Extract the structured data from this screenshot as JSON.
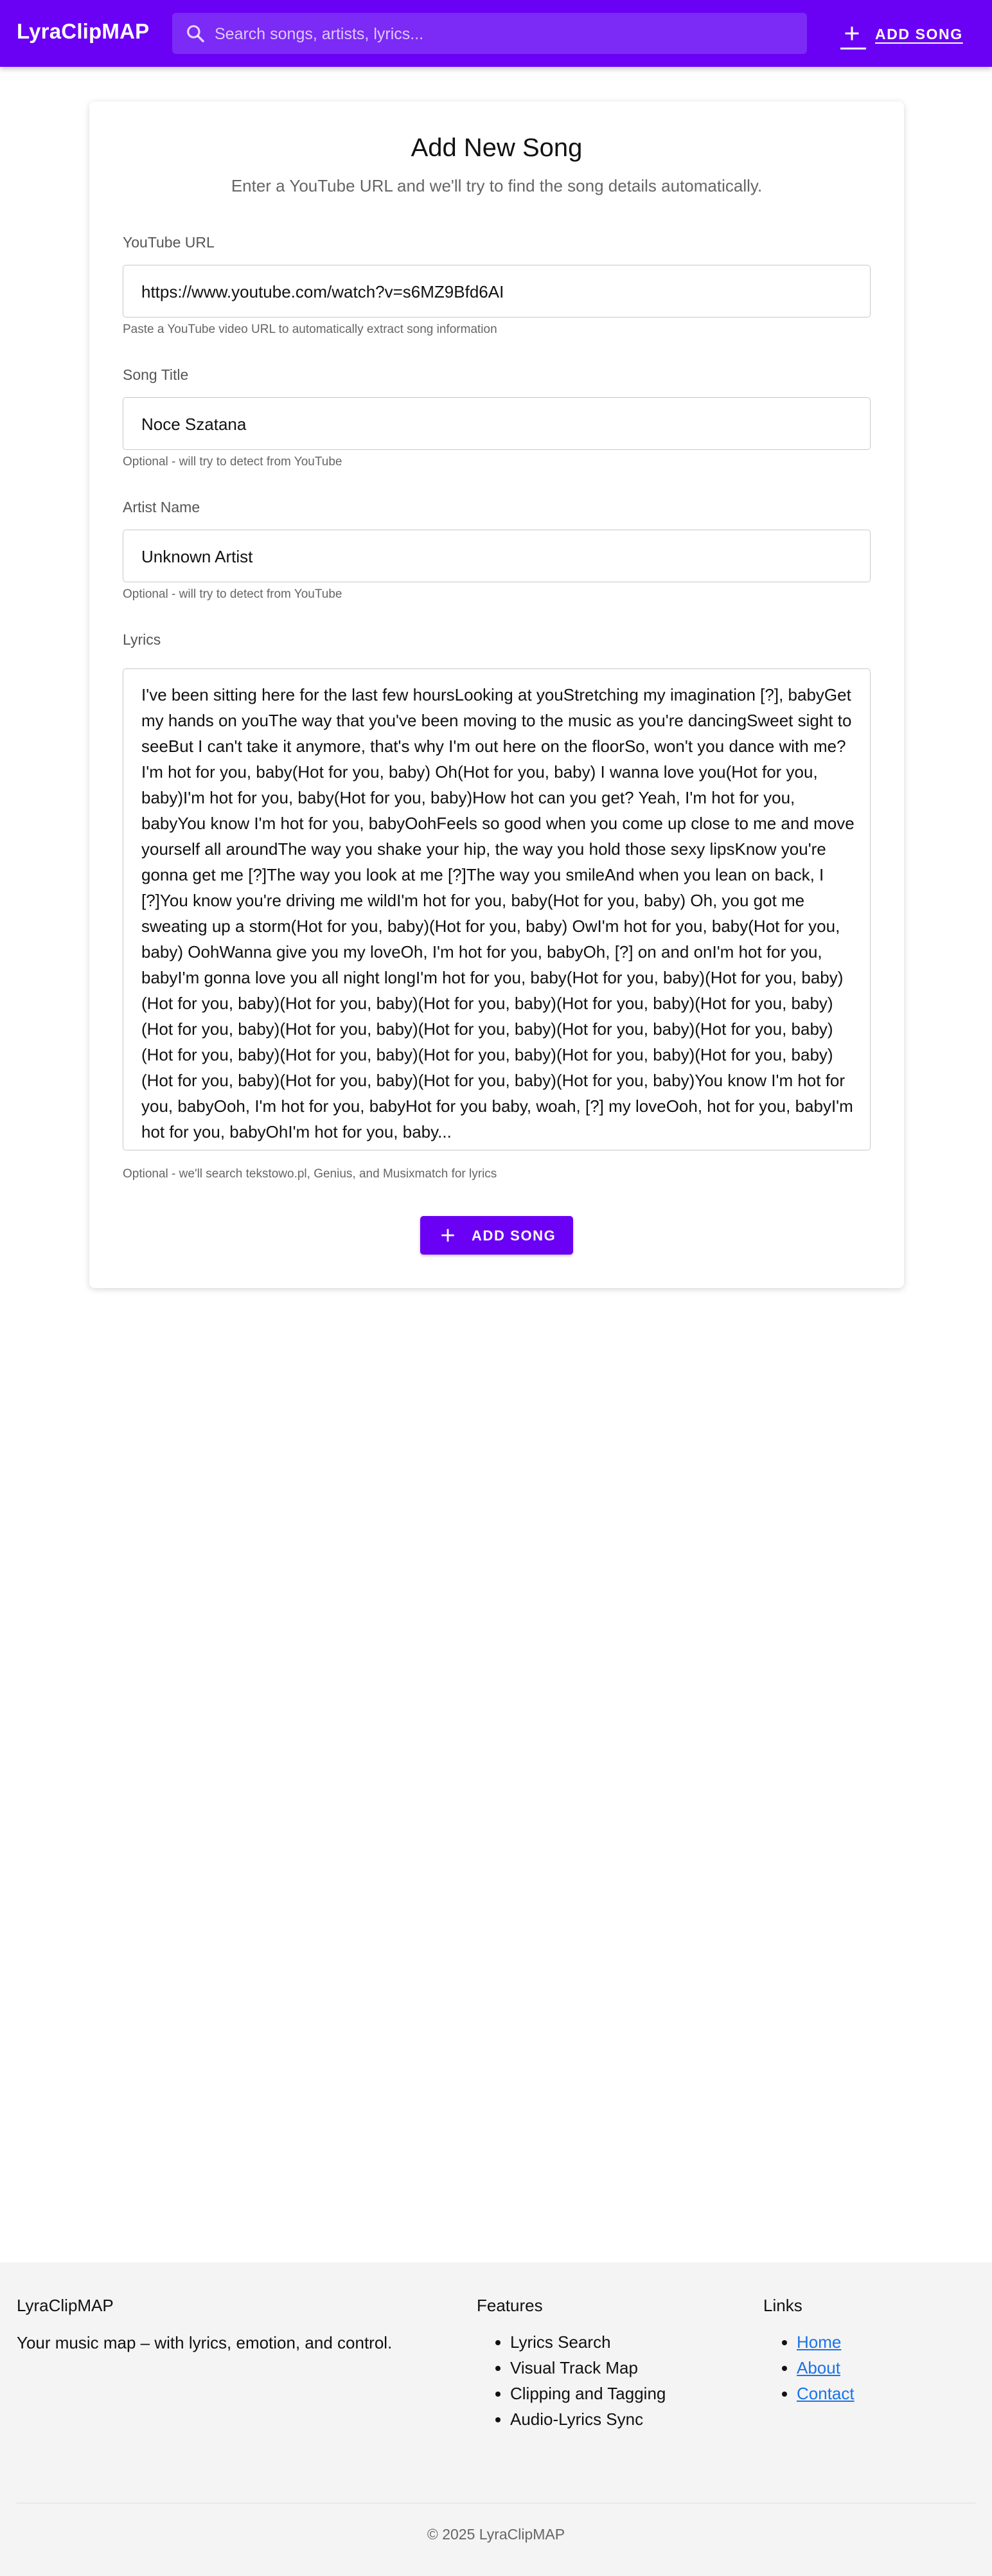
{
  "header": {
    "brand": "LyraClipMAP",
    "search_placeholder": "Search songs, artists, lyrics...",
    "add_song_label": "ADD SONG",
    "search_icon": "search-icon",
    "add_icon": "plus-icon"
  },
  "form": {
    "title": "Add New Song",
    "subtitle": "Enter a YouTube URL and we'll try to find the song details automatically.",
    "youtube": {
      "label": "YouTube URL",
      "value": "https://www.youtube.com/watch?v=s6MZ9Bfd6AI",
      "hint": "Paste a YouTube video URL to automatically extract song information"
    },
    "song_title": {
      "label": "Song Title",
      "value": "Noce Szatana",
      "hint": "Optional - will try to detect from YouTube"
    },
    "artist": {
      "label": "Artist Name",
      "value": "Unknown Artist",
      "hint": "Optional - will try to detect from YouTube"
    },
    "lyrics": {
      "label": "Lyrics",
      "value": "I've been sitting here for the last few hoursLooking at youStretching my imagination [?], babyGet my hands on youThe way that you've been moving to the music as you're dancingSweet sight to seeBut I can't take it anymore, that's why I'm out here on the floorSo, won't you dance with me?I'm hot for you, baby(Hot for you, baby) Oh(Hot for you, baby) I wanna love you(Hot for you, baby)I'm hot for you, baby(Hot for you, baby)How hot can you get? Yeah, I'm hot for you, babyYou know I'm hot for you, babyOohFeels so good when you come up close to me and move yourself all aroundThe way you shake your hip, the way you hold those sexy lipsKnow you're gonna get me [?]The way you look at me [?]The way you smileAnd when you lean on back, I [?]You know you're driving me wildI'm hot for you, baby(Hot for you, baby) Oh, you got me sweating up a storm(Hot for you, baby)(Hot for you, baby) OwI'm hot for you, baby(Hot for you, baby) OohWanna give you my loveOh, I'm hot for you, babyOh, [?] on and onI'm hot for you, babyI'm gonna love you all night longI'm hot for you, baby(Hot for you, baby)(Hot for you, baby)(Hot for you, baby)(Hot for you, baby)(Hot for you, baby)(Hot for you, baby)(Hot for you, baby)(Hot for you, baby)(Hot for you, baby)(Hot for you, baby)(Hot for you, baby)(Hot for you, baby)(Hot for you, baby)(Hot for you, baby)(Hot for you, baby)(Hot for you, baby)(Hot for you, baby)(Hot for you, baby)(Hot for you, baby)(Hot for you, baby)(Hot for you, baby)You know I'm hot for you, babyOoh, I'm hot for you, babyHot for you baby, woah, [?] my loveOoh, hot for you, babyI'm hot for you, babyOhI'm hot for you, baby...",
      "hint": "Optional - we'll search tekstowo.pl, Genius, and Musixmatch for lyrics"
    },
    "submit_label": "ADD SONG"
  },
  "footer": {
    "brand": "LyraClipMAP",
    "tagline": "Your music map – with lyrics, emotion, and control.",
    "features_title": "Features",
    "features": [
      "Lyrics Search",
      "Visual Track Map",
      "Clipping and Tagging",
      "Audio-Lyrics Sync"
    ],
    "links_title": "Links",
    "links": [
      "Home",
      "About",
      "Contact"
    ],
    "copyright": "© 2025 LyraClipMAP"
  },
  "colors": {
    "primary": "#6a00f4",
    "search_bg": "#7c2af6",
    "link": "#1a73e8"
  }
}
